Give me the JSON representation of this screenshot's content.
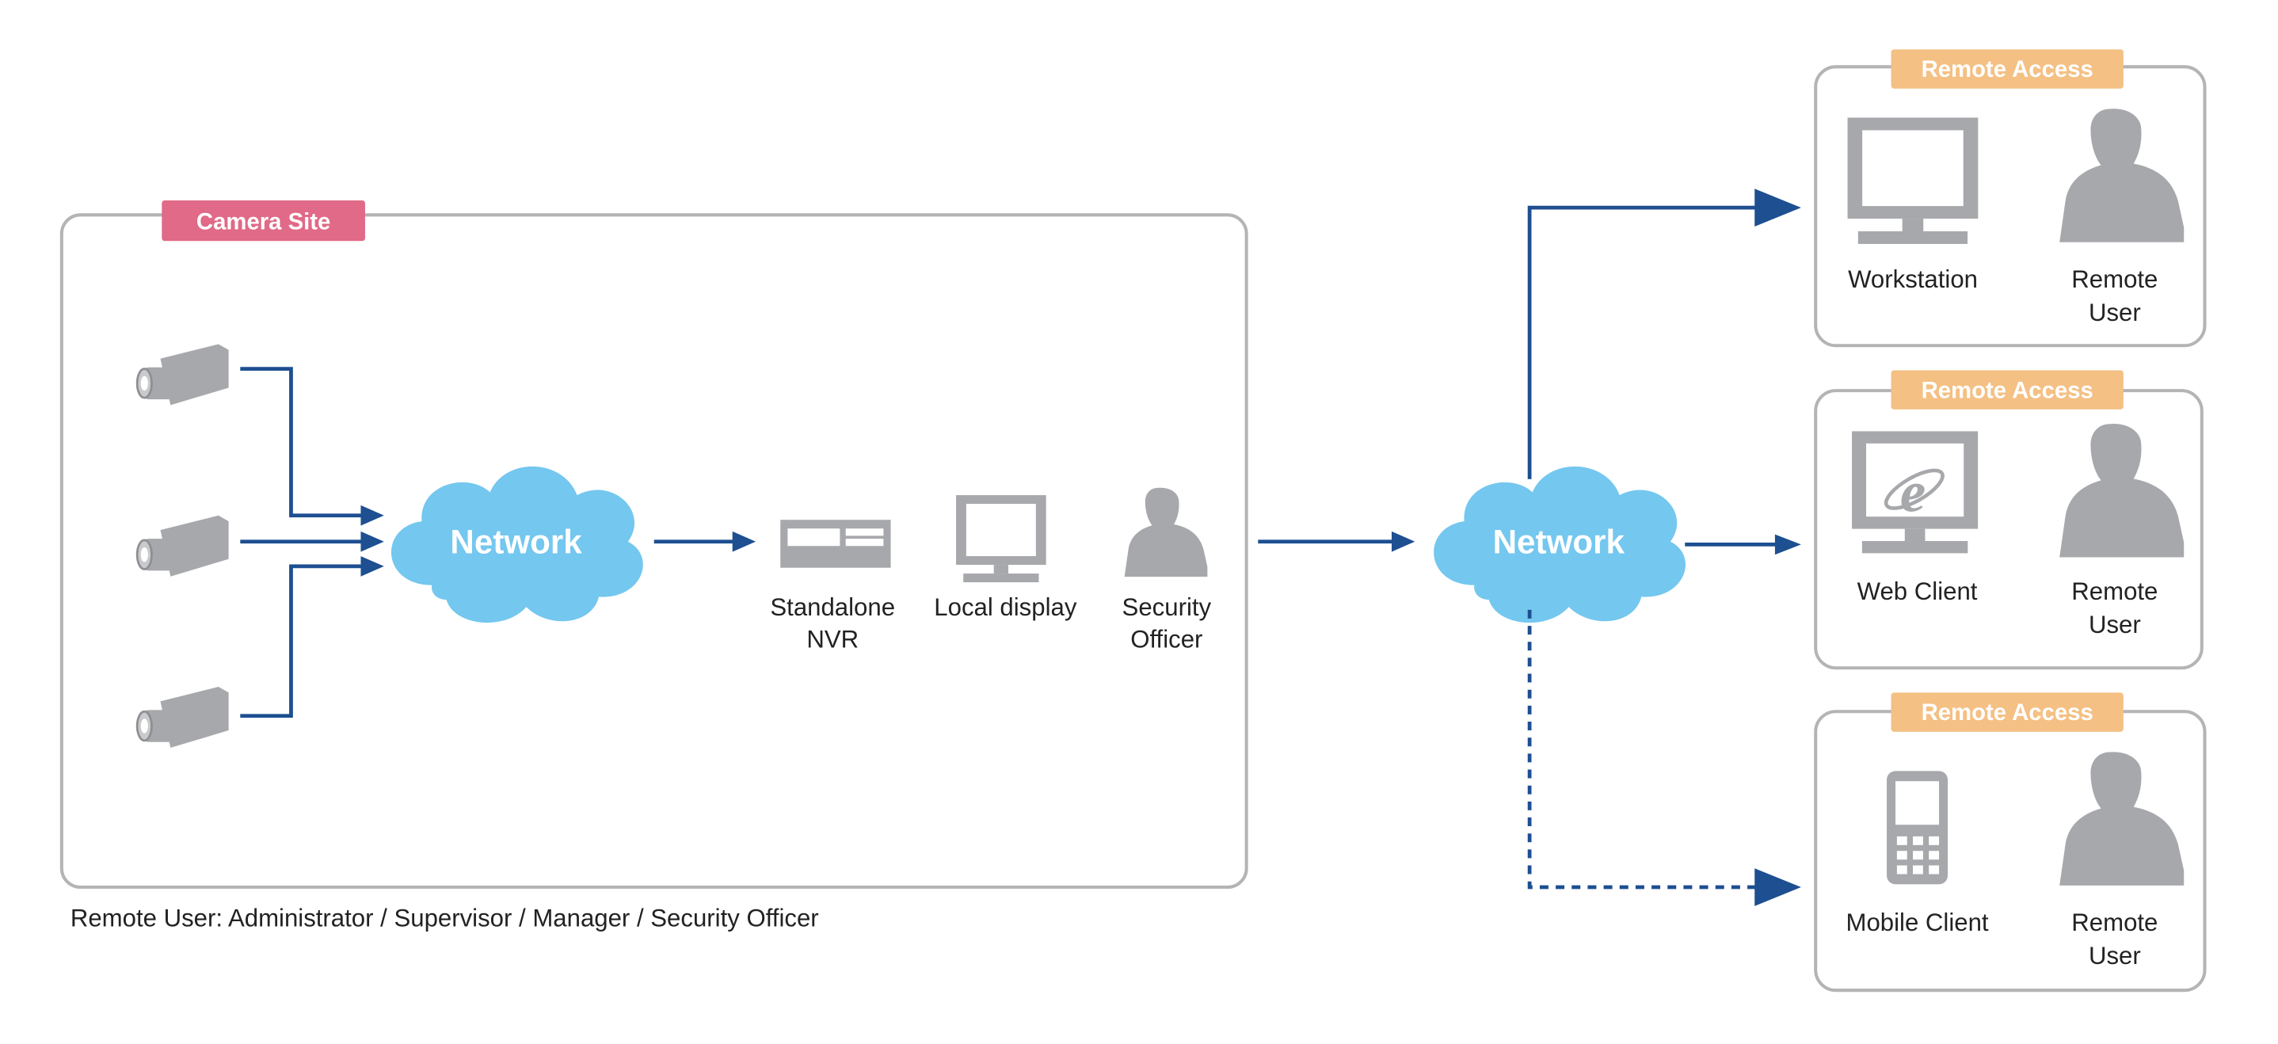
{
  "colors": {
    "camera_site_tag": "#e06a87",
    "remote_access_tag": "#f4c084",
    "cloud": "#74c7ef",
    "connector": "#1d4f91",
    "icon": "#a7a8ab",
    "box_border": "#b4b4b4"
  },
  "camera_site": {
    "tag": "Camera Site",
    "cameras": [
      "camera-icon",
      "camera-icon",
      "camera-icon"
    ],
    "network": "Network",
    "devices": [
      {
        "icon": "nvr-icon",
        "line1": "Standalone",
        "line2": "NVR"
      },
      {
        "icon": "monitor-icon",
        "line1": "Local display",
        "line2": ""
      },
      {
        "icon": "person-icon",
        "line1": "Security",
        "line2": "Officer"
      }
    ]
  },
  "wan": {
    "network": "Network"
  },
  "remote_groups": [
    {
      "tag": "Remote Access",
      "client_icon": "monitor-icon",
      "client": "Workstation",
      "user_line1": "Remote",
      "user_line2": "User",
      "link": "solid"
    },
    {
      "tag": "Remote Access",
      "client_icon": "web-browser-monitor-icon",
      "client": "Web Client",
      "user_line1": "Remote",
      "user_line2": "User",
      "link": "solid"
    },
    {
      "tag": "Remote Access",
      "client_icon": "mobile-phone-icon",
      "client": "Mobile Client",
      "user_line1": "Remote",
      "user_line2": "User",
      "link": "dashed"
    }
  ],
  "footnote": "Remote User: Administrator / Supervisor / Manager / Security Officer"
}
